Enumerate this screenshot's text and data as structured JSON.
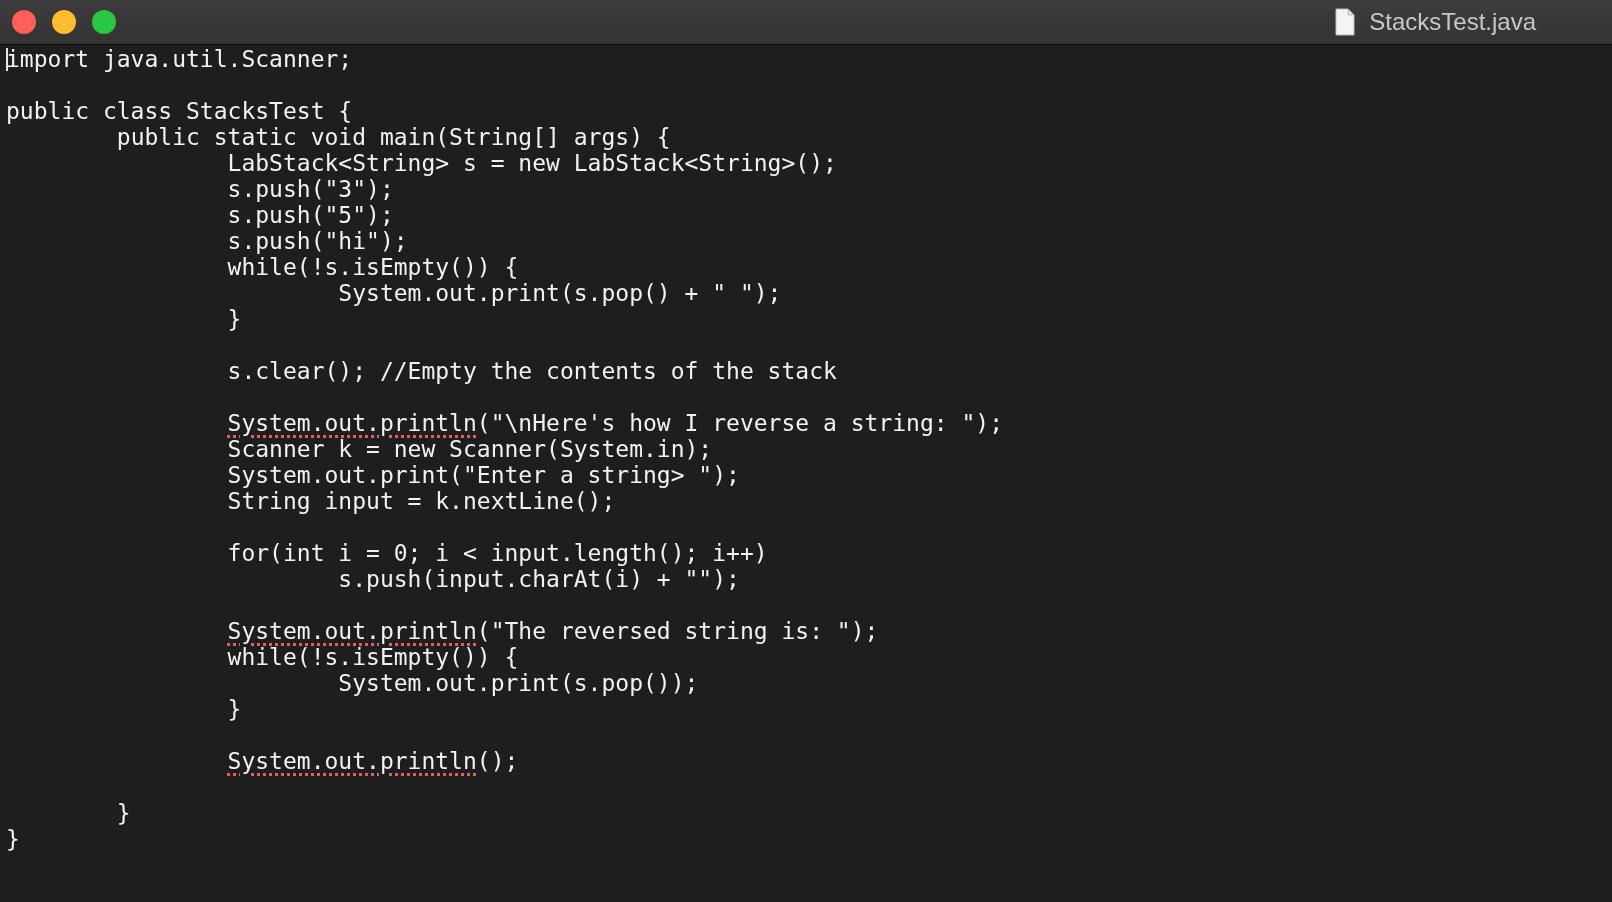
{
  "window": {
    "title": "StacksTest.java"
  },
  "editor": {
    "lines": [
      {
        "kind": "code",
        "cursor": true,
        "segments": [
          {
            "text": "import java.util.Scanner;",
            "flagged": false
          }
        ]
      },
      {
        "kind": "blank"
      },
      {
        "kind": "code",
        "cursor": false,
        "segments": [
          {
            "text": "public class StacksTest {",
            "flagged": false
          }
        ]
      },
      {
        "kind": "code",
        "cursor": false,
        "segments": [
          {
            "text": "\tpublic static void main(String[] args) {",
            "flagged": false
          }
        ]
      },
      {
        "kind": "code",
        "cursor": false,
        "segments": [
          {
            "text": "\t\tLabStack<String> s = new LabStack<String>();",
            "flagged": false
          }
        ]
      },
      {
        "kind": "code",
        "cursor": false,
        "segments": [
          {
            "text": "\t\ts.push(\"3\");",
            "flagged": false
          }
        ]
      },
      {
        "kind": "code",
        "cursor": false,
        "segments": [
          {
            "text": "\t\ts.push(\"5\");",
            "flagged": false
          }
        ]
      },
      {
        "kind": "code",
        "cursor": false,
        "segments": [
          {
            "text": "\t\ts.push(\"hi\");",
            "flagged": false
          }
        ]
      },
      {
        "kind": "code",
        "cursor": false,
        "segments": [
          {
            "text": "\t\twhile(!s.isEmpty()) {",
            "flagged": false
          }
        ]
      },
      {
        "kind": "code",
        "cursor": false,
        "segments": [
          {
            "text": "\t\t\tSystem.out.print(s.pop() + \" \");",
            "flagged": false
          }
        ]
      },
      {
        "kind": "code",
        "cursor": false,
        "segments": [
          {
            "text": "\t\t}",
            "flagged": false
          }
        ]
      },
      {
        "kind": "blank"
      },
      {
        "kind": "code",
        "cursor": false,
        "segments": [
          {
            "text": "\t\ts.clear(); //Empty the contents of the stack",
            "flagged": false
          }
        ]
      },
      {
        "kind": "blank"
      },
      {
        "kind": "code",
        "cursor": false,
        "segments": [
          {
            "text": "\t\tSystem.out.println",
            "flagged": true
          },
          {
            "text": "(\"\\nHere's how I reverse a string: \");",
            "flagged": false
          }
        ]
      },
      {
        "kind": "code",
        "cursor": false,
        "segments": [
          {
            "text": "\t\tScanner k = new Scanner(System.in);",
            "flagged": false
          }
        ]
      },
      {
        "kind": "code",
        "cursor": false,
        "segments": [
          {
            "text": "\t\tSystem.out.print(\"Enter a string> \");",
            "flagged": false
          }
        ]
      },
      {
        "kind": "code",
        "cursor": false,
        "segments": [
          {
            "text": "\t\tString input = k.nextLine();",
            "flagged": false
          }
        ]
      },
      {
        "kind": "blank"
      },
      {
        "kind": "code",
        "cursor": false,
        "segments": [
          {
            "text": "\t\tfor(int i = 0; i < input.length(); i++)",
            "flagged": false
          }
        ]
      },
      {
        "kind": "code",
        "cursor": false,
        "segments": [
          {
            "text": "\t\t\ts.push(input.charAt(i) + \"\");",
            "flagged": false
          }
        ]
      },
      {
        "kind": "blank"
      },
      {
        "kind": "code",
        "cursor": false,
        "segments": [
          {
            "text": "\t\tSystem.out.println",
            "flagged": true
          },
          {
            "text": "(\"The reversed string is: \");",
            "flagged": false
          }
        ]
      },
      {
        "kind": "code",
        "cursor": false,
        "segments": [
          {
            "text": "\t\twhile(!s.isEmpty()) {",
            "flagged": false
          }
        ]
      },
      {
        "kind": "code",
        "cursor": false,
        "segments": [
          {
            "text": "\t\t\tSystem.out.print(s.pop());",
            "flagged": false
          }
        ]
      },
      {
        "kind": "code",
        "cursor": false,
        "segments": [
          {
            "text": "\t\t}",
            "flagged": false
          }
        ]
      },
      {
        "kind": "blank"
      },
      {
        "kind": "code",
        "cursor": false,
        "segments": [
          {
            "text": "\t\tSystem.out.println",
            "flagged": true
          },
          {
            "text": "();",
            "flagged": false
          }
        ]
      },
      {
        "kind": "blank"
      },
      {
        "kind": "code",
        "cursor": false,
        "segments": [
          {
            "text": "\t}",
            "flagged": false
          }
        ]
      },
      {
        "kind": "code",
        "cursor": false,
        "segments": [
          {
            "text": "}",
            "flagged": false
          }
        ]
      }
    ]
  }
}
